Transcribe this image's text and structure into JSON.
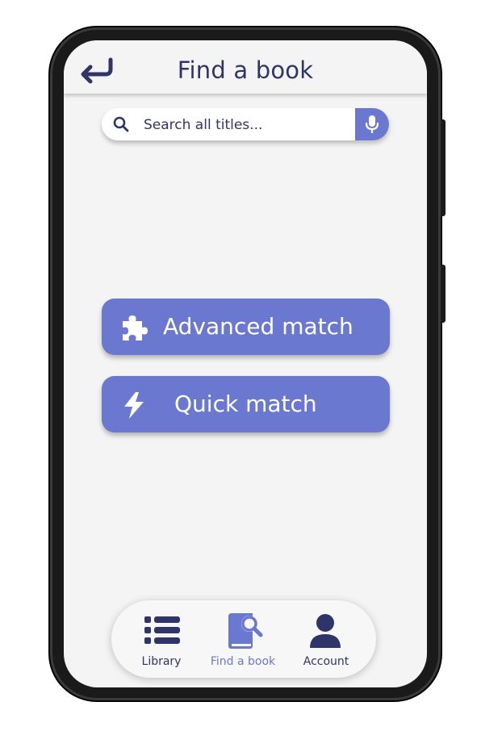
{
  "header": {
    "title": "Find a book",
    "back_icon": "return-arrow-icon"
  },
  "search": {
    "placeholder": "Search all titles...",
    "value": "",
    "search_icon": "search-icon",
    "mic_icon": "microphone-icon"
  },
  "actions": [
    {
      "label": "Advanced match",
      "icon": "puzzle-icon"
    },
    {
      "label": "Quick match",
      "icon": "lightning-icon"
    }
  ],
  "nav": {
    "items": [
      {
        "label": "Library",
        "icon": "list-icon",
        "active": false
      },
      {
        "label": "Find a book",
        "icon": "book-search-icon",
        "active": true
      },
      {
        "label": "Account",
        "icon": "person-icon",
        "active": false
      }
    ]
  },
  "colors": {
    "primary": "#6b78cf",
    "text": "#2f3569",
    "background": "#f4f4f5"
  }
}
